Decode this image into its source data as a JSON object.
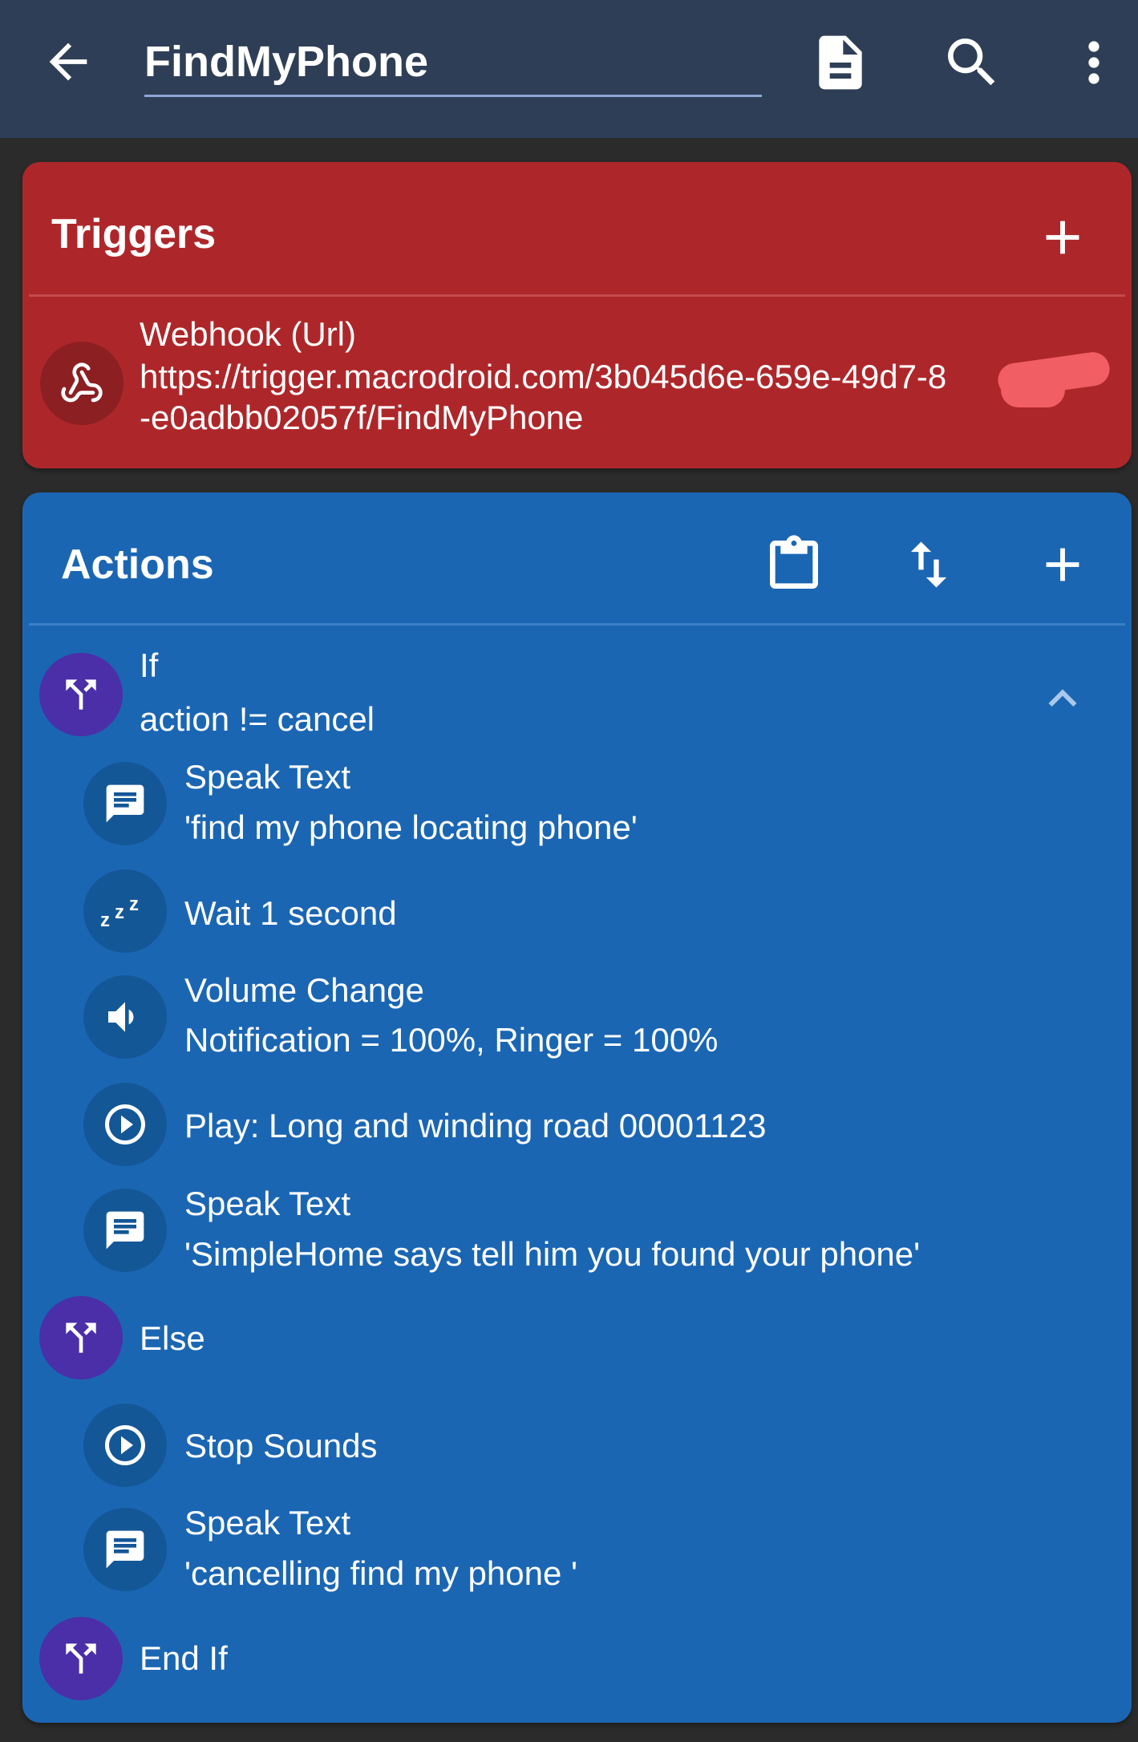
{
  "appbar": {
    "title": "FindMyPhone",
    "icons": [
      "back-arrow-icon",
      "document-icon",
      "search-icon",
      "more-vert-icon"
    ]
  },
  "triggers": {
    "title": "Triggers",
    "items": [
      {
        "icon": "webhook-icon",
        "name": "Webhook (Url)",
        "url_line1": "https://trigger.macrodroid.com/3b045d6e-659e-49d7-8",
        "url_line2": "-e0adbb02057f/FindMyPhone"
      }
    ]
  },
  "actions": {
    "title": "Actions",
    "items": [
      {
        "icon": "branch-icon",
        "line1": "If",
        "line2": "action != cancel"
      },
      {
        "icon": "speech-icon",
        "line1": "Speak Text",
        "line2": "'find my phone locating phone'"
      },
      {
        "icon": "sleep-icon",
        "line1": "Wait 1 second"
      },
      {
        "icon": "volume-icon",
        "line1": "Volume Change",
        "line2": "Notification = 100%, Ringer = 100%"
      },
      {
        "icon": "play-icon",
        "line1": "Play: Long and winding road 00001123"
      },
      {
        "icon": "speech-icon",
        "line1": "Speak Text",
        "line2": "'SimpleHome says tell him you found your phone'"
      },
      {
        "icon": "branch-icon",
        "line1": "Else"
      },
      {
        "icon": "play-icon",
        "line1": "Stop Sounds"
      },
      {
        "icon": "speech-icon",
        "line1": "Speak Text",
        "line2": "'cancelling find my phone '"
      },
      {
        "icon": "branch-icon",
        "line1": "End If"
      }
    ]
  },
  "colors": {
    "appbar": "#2e3e56",
    "triggers_bg": "#ad272a",
    "actions_bg": "#1b66b3",
    "branch_circle": "#4a2fa8"
  }
}
